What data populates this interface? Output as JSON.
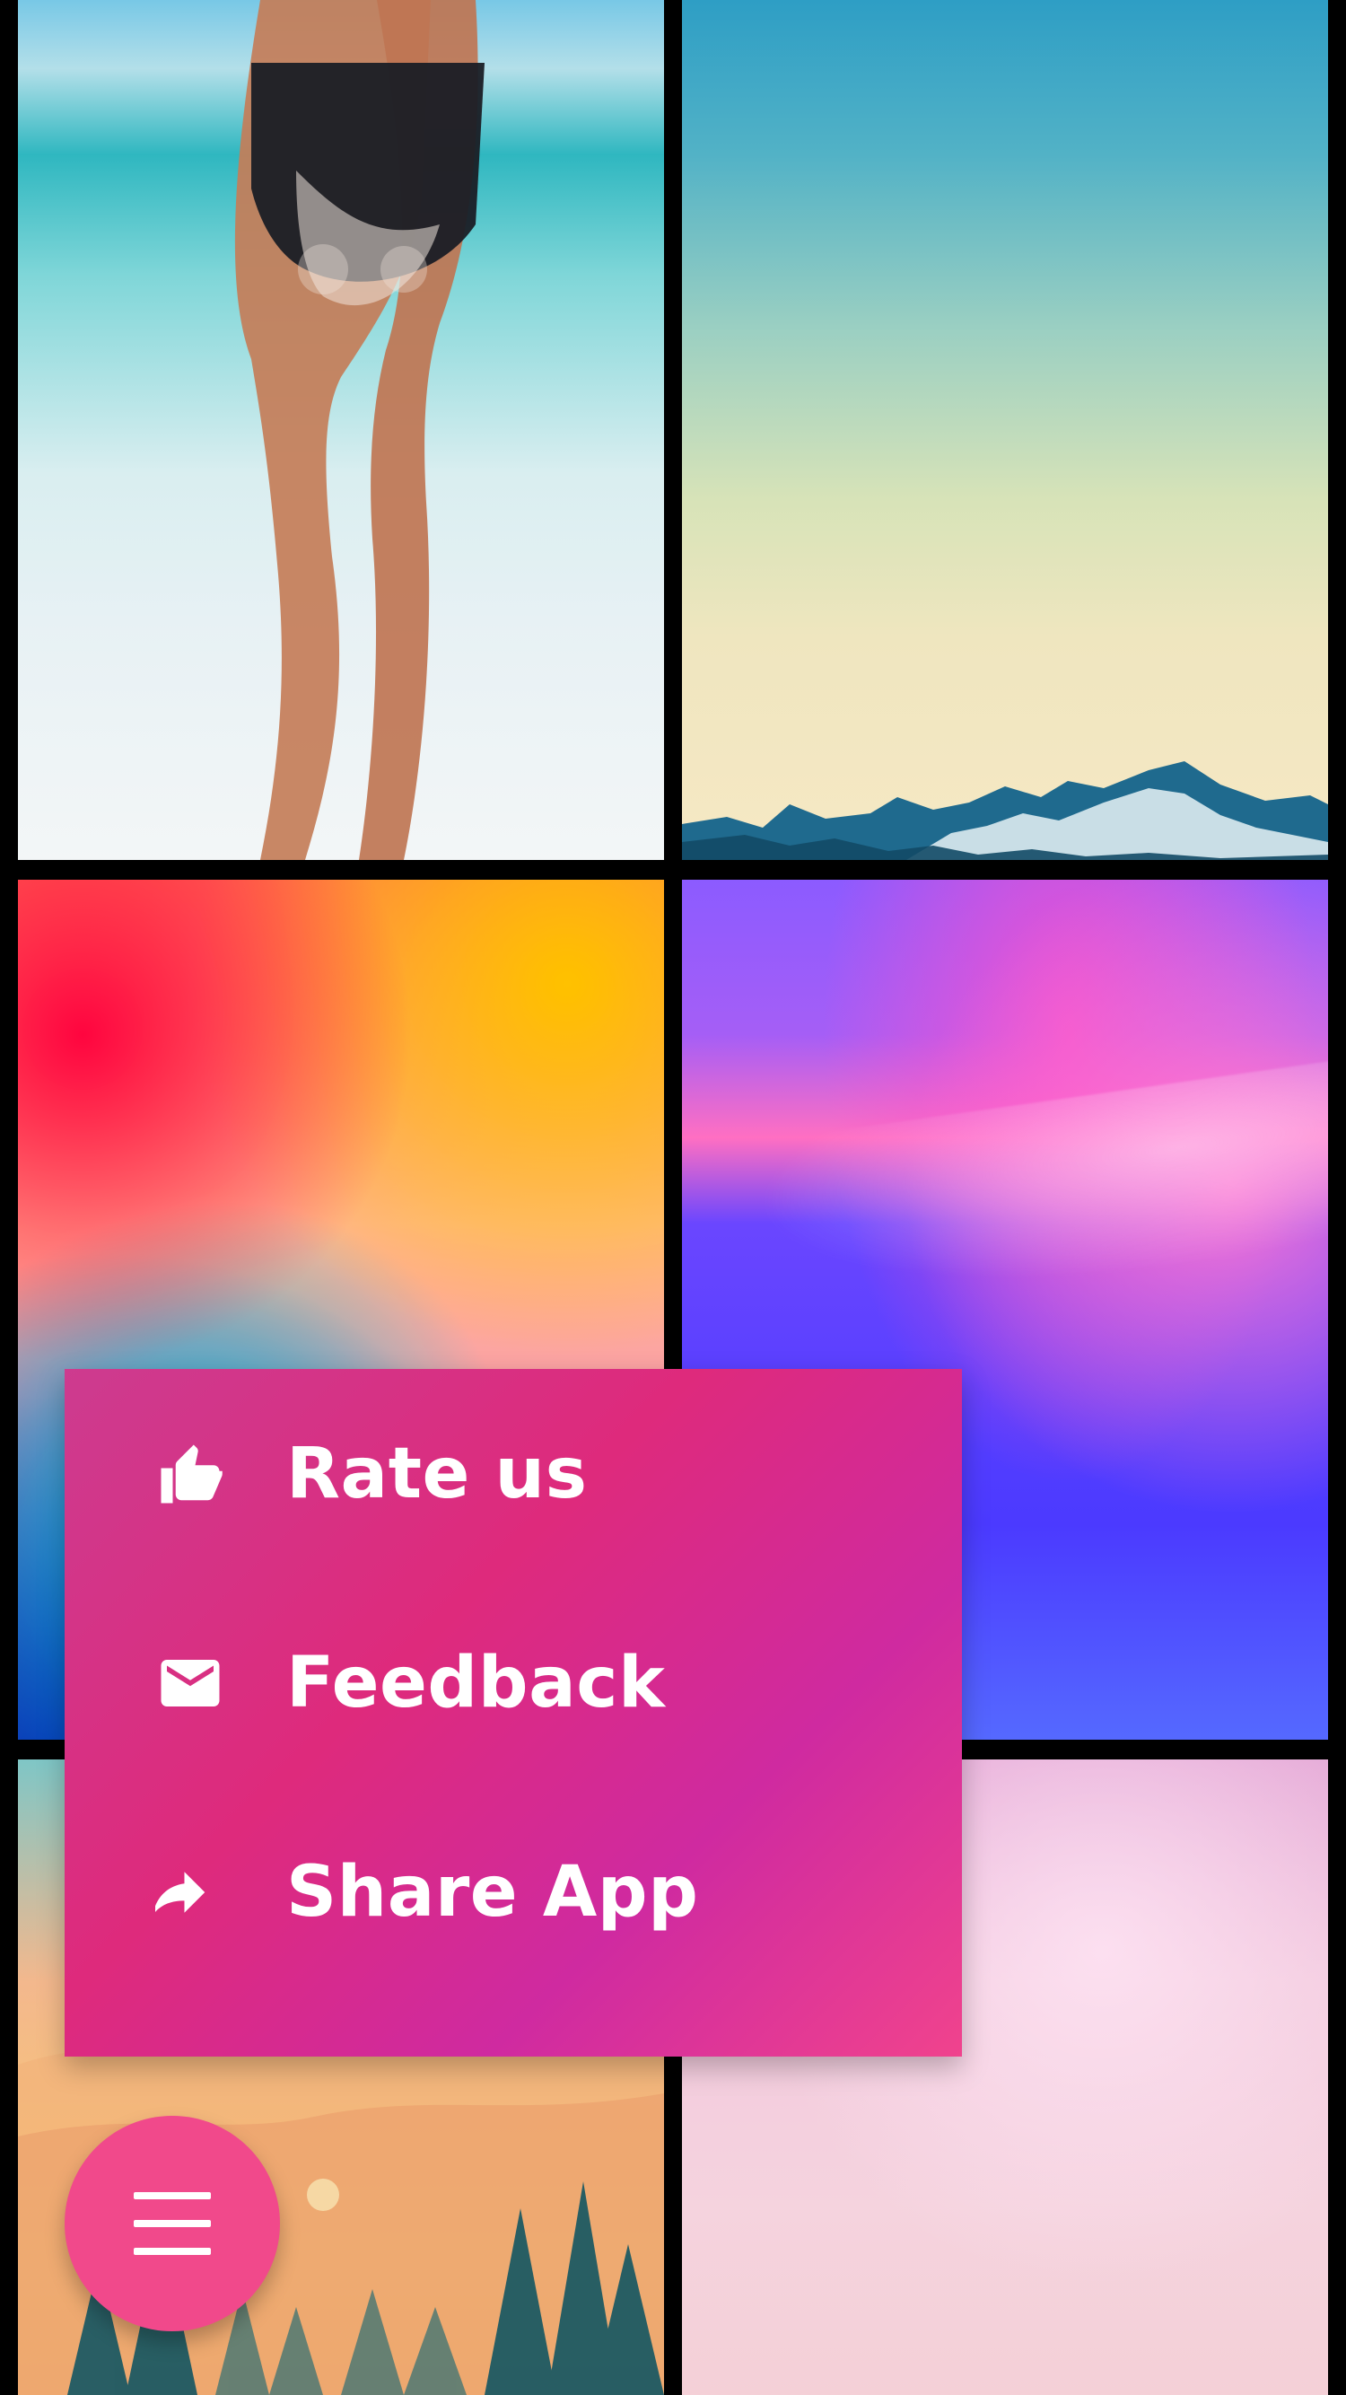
{
  "wallpapers": [
    {
      "icon": "beach-photo"
    },
    {
      "icon": "sky-mountain-photo"
    },
    {
      "icon": "warm-gradient"
    },
    {
      "icon": "purple-waves"
    },
    {
      "icon": "forest-illustration"
    },
    {
      "icon": "pastel-pink"
    }
  ],
  "menu": {
    "items": [
      {
        "label": "Rate us",
        "icon": "thumbs-up-icon"
      },
      {
        "label": "Feedback",
        "icon": "mail-icon"
      },
      {
        "label": "Share App",
        "icon": "share-icon"
      }
    ]
  },
  "fab": {
    "icon": "hamburger-menu-icon"
  },
  "colors": {
    "menu_bg": "#de2a7c",
    "fab_bg": "#f1498b",
    "text": "#ffffff",
    "app_bg": "#000000"
  }
}
